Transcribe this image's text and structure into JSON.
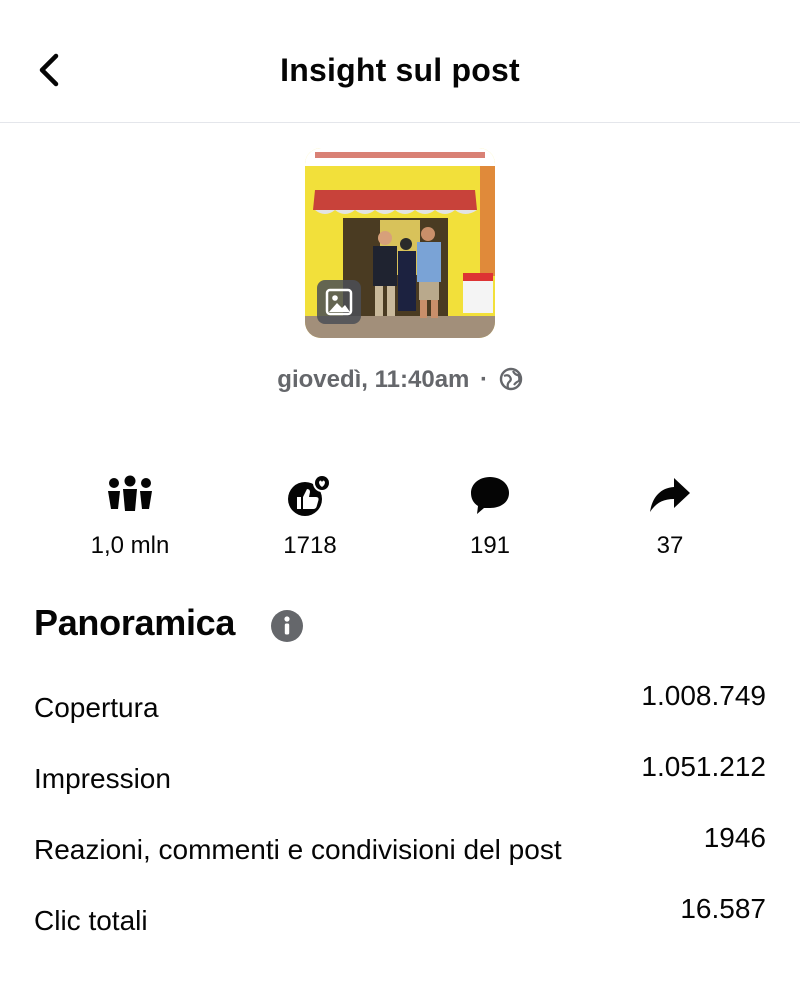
{
  "header": {
    "title": "Insight sul post",
    "back_icon": "chevron-left-icon"
  },
  "post": {
    "thumbnail_icon": "photo-icon",
    "day_time": "giovedì, 11:40am",
    "separator": "·",
    "privacy_icon": "globe-icon"
  },
  "stats": [
    {
      "icon": "people-icon",
      "value": "1,0 mln"
    },
    {
      "icon": "reactions-icon",
      "value": "1718"
    },
    {
      "icon": "comment-icon",
      "value": "191"
    },
    {
      "icon": "share-icon",
      "value": "37"
    }
  ],
  "overview": {
    "title": "Panoramica",
    "info_icon": "info-icon",
    "rows": [
      {
        "label": "Copertura",
        "value": "1.008.749"
      },
      {
        "label": "Impression",
        "value": "1.051.212"
      },
      {
        "label": "Reazioni, commenti e condivisioni del post",
        "value": "1946"
      },
      {
        "label": "Clic totali",
        "value": "16.587"
      }
    ]
  },
  "colors": {
    "text": "#050505",
    "secondary": "#65676b",
    "divider": "#e4e6eb",
    "thumb_wall": "#f2e03a"
  }
}
